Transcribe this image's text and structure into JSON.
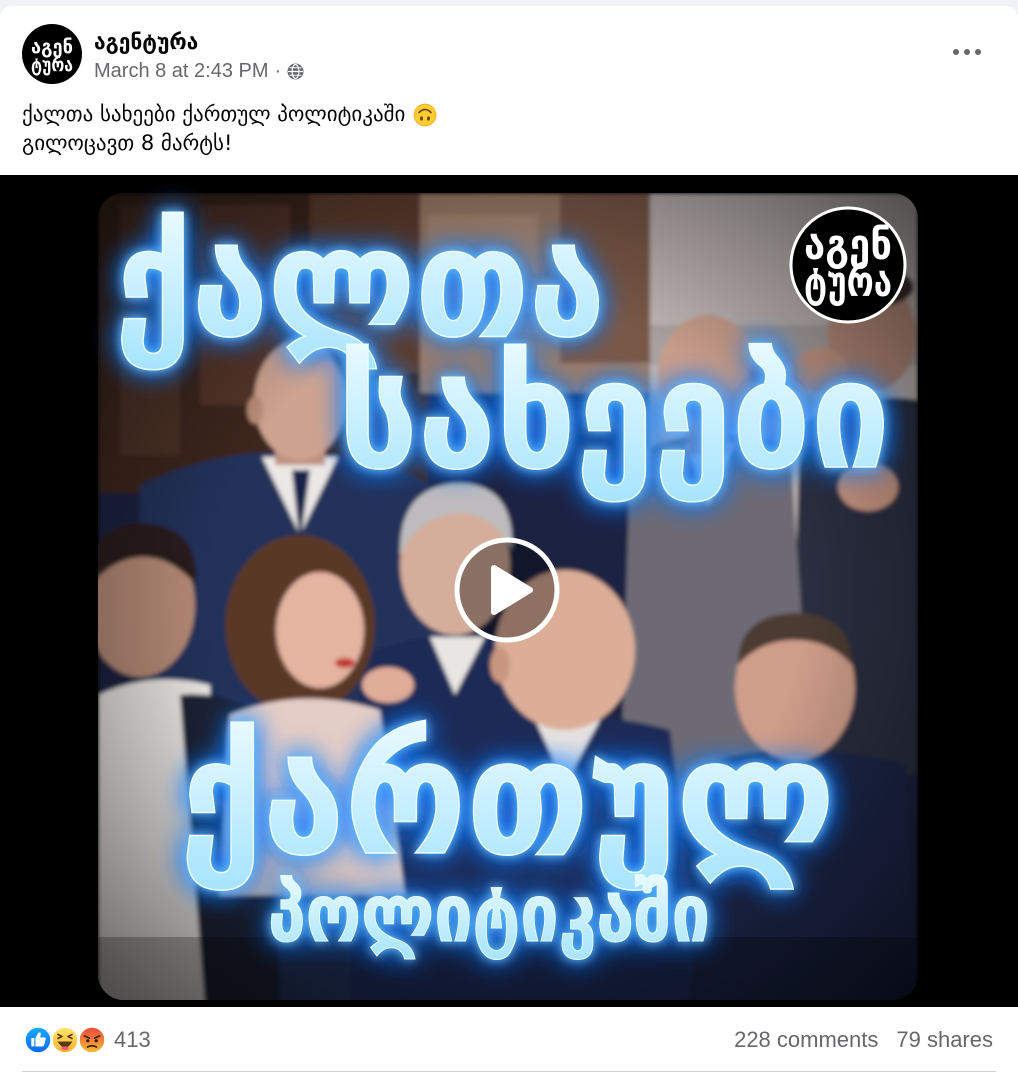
{
  "post": {
    "author": {
      "name": "აგენტურა",
      "avatar_text": [
        "აგენ",
        "ტურა"
      ]
    },
    "timestamp": "March 8 at 2:43 PM",
    "separator": "·",
    "privacy_icon": "globe-icon",
    "more_icon": "more-options-icon",
    "text_lines": [
      "ქალთა სახეები ქართულ პოლიტიკაში",
      "გილოცავთ 8 მარტს!"
    ],
    "text_emoji": "upside-down-face-emoji"
  },
  "video": {
    "overlay_lines": [
      "ქალთა",
      "სახეები",
      "ქართულ",
      "პოლიტიკაში"
    ],
    "logo_text": [
      "აგენ",
      "ტურა"
    ],
    "play_icon": "play-icon"
  },
  "footer": {
    "reaction_icons": [
      "like-icon",
      "haha-icon",
      "angry-icon"
    ],
    "reaction_count": "413",
    "comments": "228 comments",
    "shares": "79 shares"
  },
  "colors": {
    "text_primary": "#050505",
    "text_secondary": "#65676b",
    "like_blue": "#1877f2",
    "divider": "#ced0d4",
    "neon_glow": "#1f7bff",
    "neon_fill": "#c8f0ff"
  }
}
